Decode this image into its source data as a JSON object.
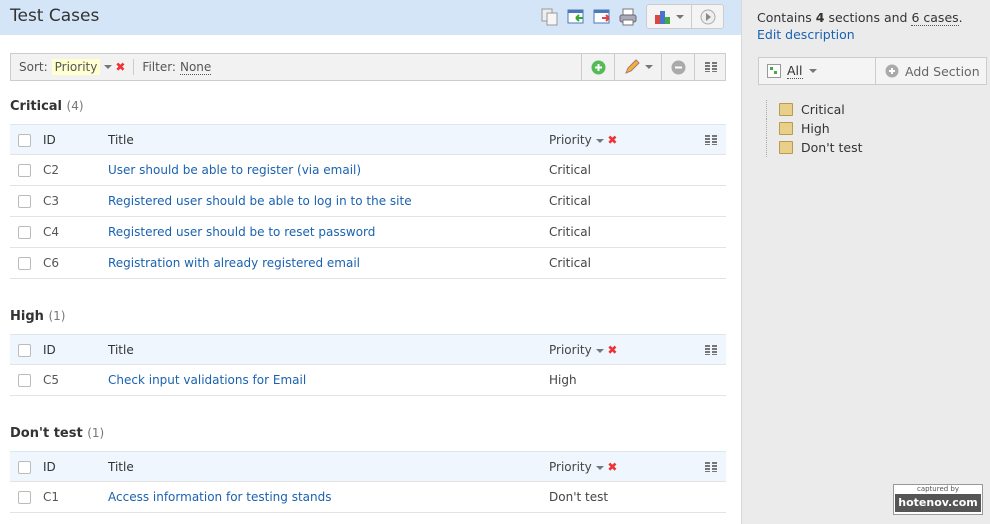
{
  "header": {
    "title": "Test Cases",
    "icons": [
      "copy-icon",
      "import-icon",
      "export-icon",
      "print-icon",
      "report-chart-icon",
      "run-icon"
    ]
  },
  "sortbar": {
    "sort_label": "Sort:",
    "sort_value": "Priority",
    "filter_label": "Filter:",
    "filter_value": "None"
  },
  "columns": {
    "id": "ID",
    "title": "Title",
    "priority": "Priority"
  },
  "sections": [
    {
      "name": "Critical",
      "count": "(4)",
      "cases": [
        {
          "id": "C2",
          "title": "User should be able to register (via email)",
          "priority": "Critical"
        },
        {
          "id": "C3",
          "title": "Registered user should be able to log in to the site",
          "priority": "Critical"
        },
        {
          "id": "C4",
          "title": "Registered user should be to reset password",
          "priority": "Critical"
        },
        {
          "id": "C6",
          "title": "Registration with already registered email",
          "priority": "Critical"
        }
      ]
    },
    {
      "name": "High",
      "count": "(1)",
      "cases": [
        {
          "id": "C5",
          "title": "Check input validations for Email",
          "priority": "High"
        }
      ]
    },
    {
      "name": "Don't test",
      "count": "(1)",
      "cases": [
        {
          "id": "C1",
          "title": "Access information for testing stands",
          "priority": "Don't test"
        }
      ]
    }
  ],
  "sidebar": {
    "contains": "Contains",
    "sections_count": "4",
    "sections_word": "sections and",
    "cases_link": "6 cases",
    "edit_link": "Edit description",
    "filter_label": "All",
    "add_section": "Add Section",
    "tree": [
      "Critical",
      "High",
      "Don't test"
    ]
  },
  "watermark": {
    "line1": "captured by",
    "line2": "hotenov.com"
  }
}
